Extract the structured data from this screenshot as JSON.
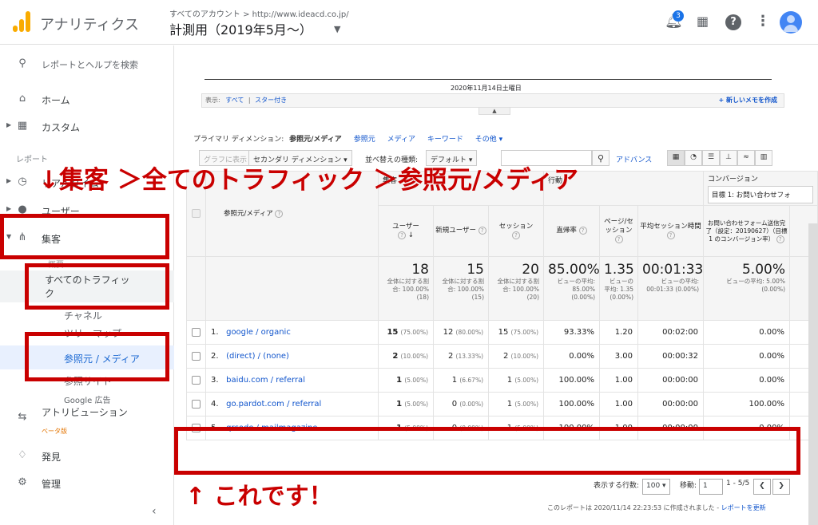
{
  "header": {
    "app_name": "アナリティクス",
    "account_path": "すべてのアカウント > http://www.ideacd.co.jp/",
    "view_name": "計測用（2019年5月〜）",
    "notifications_count": "3"
  },
  "sidebar": {
    "search_label": "レポートとヘルプを検索",
    "home": "ホーム",
    "custom": "カスタム",
    "reports_section": "レポート",
    "realtime": "リアルタイム",
    "audience": "ユーザー",
    "acquisition": "集客",
    "overview": "概要",
    "all_traffic": "すべてのトラフィック",
    "channels": "チャネル",
    "treemap": "ツリーマップ",
    "source_medium": "参照元 / メディア",
    "referrals": "参照サイト",
    "google_ads": "Google 広告",
    "attribution": "アトリビューション",
    "attribution_badge": "ベータ版",
    "discover": "発見",
    "admin": "管理"
  },
  "chart": {
    "date_label": "2020年11月14日土曜日"
  },
  "notes": {
    "show_label": "表示:",
    "all": "すべて",
    "starred": "スター付き",
    "new_note": "+ 新しいメモを作成"
  },
  "dimension": {
    "label": "プライマリ ディメンション:",
    "current": "参照元/メディア",
    "opt1": "参照元",
    "opt2": "メディア",
    "opt3": "キーワード",
    "opt4": "その他 ▾"
  },
  "toolbar": {
    "graph_btn": "グラフに表示",
    "secondary_dim": "セカンダリ ディメンション ▾",
    "sort_label": "並べ替えの種類:",
    "sort_value": "デフォルト ▾",
    "advanced": "アドバンス"
  },
  "table": {
    "group_acq": "集客",
    "group_beh": "行動",
    "group_conv": "コンバージョン",
    "goal_select": "目標 1: お問い合わせフォ",
    "col_dim": "参照元/メディア",
    "col_users": "ユーザー",
    "col_new": "新規ユーザー",
    "col_sess": "セッション",
    "col_bounce": "直帰率",
    "col_pps": "ページ/セッション",
    "col_dur": "平均セッション時間",
    "col_goal": "お問い合わせフォーム送信完了（設定：20190627）（目標 1 のコンバージョン率）",
    "totals": [
      {
        "value": "18",
        "sub": "全体に対する割合: 100.00% (18)"
      },
      {
        "value": "15",
        "sub": "全体に対する割合: 100.00% (15)"
      },
      {
        "value": "20",
        "sub": "全体に対する割合: 100.00% (20)"
      },
      {
        "value": "85.00%",
        "sub": "ビューの平均: 85.00% (0.00%)"
      },
      {
        "value": "1.35",
        "sub": "ビューの平均: 1.35 (0.00%)"
      },
      {
        "value": "00:01:33",
        "sub": "ビューの平均: 00:01:33 (0.00%)"
      },
      {
        "value": "5.00%",
        "sub": "ビューの平均: 5.00% (0.00%)"
      }
    ],
    "rows": [
      {
        "idx": "1.",
        "name": "google / organic",
        "users": "15",
        "users_p": "(75.00%)",
        "newu": "12",
        "newu_p": "(80.00%)",
        "sess": "15",
        "sess_p": "(75.00%)",
        "bounce": "93.33%",
        "pps": "1.20",
        "dur": "00:02:00",
        "goal": "0.00%"
      },
      {
        "idx": "2.",
        "name": "(direct) / (none)",
        "users": "2",
        "users_p": "(10.00%)",
        "newu": "2",
        "newu_p": "(13.33%)",
        "sess": "2",
        "sess_p": "(10.00%)",
        "bounce": "0.00%",
        "pps": "3.00",
        "dur": "00:00:32",
        "goal": "0.00%"
      },
      {
        "idx": "3.",
        "name": "baidu.com / referral",
        "users": "1",
        "users_p": "(5.00%)",
        "newu": "1",
        "newu_p": "(6.67%)",
        "sess": "1",
        "sess_p": "(5.00%)",
        "bounce": "100.00%",
        "pps": "1.00",
        "dur": "00:00:00",
        "goal": "0.00%"
      },
      {
        "idx": "4.",
        "name": "go.pardot.com / referral",
        "users": "1",
        "users_p": "(5.00%)",
        "newu": "0",
        "newu_p": "(0.00%)",
        "sess": "1",
        "sess_p": "(5.00%)",
        "bounce": "100.00%",
        "pps": "1.00",
        "dur": "00:00:00",
        "goal": "100.00%"
      },
      {
        "idx": "5.",
        "name": "qrcode / mailmagazine",
        "users": "1",
        "users_p": "(5.00%)",
        "newu": "0",
        "newu_p": "(0.00%)",
        "sess": "1",
        "sess_p": "(5.00%)",
        "bounce": "100.00%",
        "pps": "1.00",
        "dur": "00:00:00",
        "goal": "0.00%"
      }
    ]
  },
  "pager": {
    "rows_label": "表示する行数:",
    "rows_value": "100 ▾",
    "goto_label": "移動:",
    "goto_value": "1",
    "range": "1 - 5/5",
    "prev": "❮",
    "next": "❯"
  },
  "footer": {
    "text": "このレポートは 2020/11/14 22:23:53 に作成されました - ",
    "refresh": "レポートを更新"
  },
  "annotations": {
    "path": "↓集客 ＞全てのトラフィック ＞参照元/メディア",
    "pointer": "↑ これです！",
    "color": "#c90000"
  }
}
